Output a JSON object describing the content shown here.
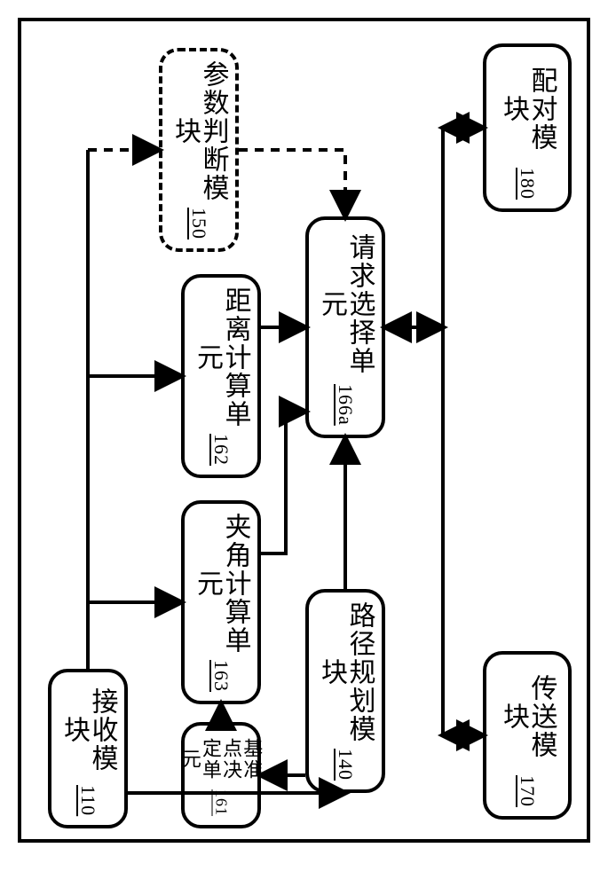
{
  "diagram": {
    "type": "block-diagram",
    "orientation": "vertical-labels",
    "nodes": {
      "receive": {
        "label": "接收模块",
        "ref": "110"
      },
      "route": {
        "label": "路径规划模块",
        "ref": "140"
      },
      "param": {
        "label": "参数判断模块",
        "ref": "150"
      },
      "refpoint": {
        "label": "基准点决定单元",
        "ref": "161"
      },
      "distance": {
        "label": "距离计算单元",
        "ref": "162"
      },
      "angle": {
        "label": "夹角计算单元",
        "ref": "163"
      },
      "select": {
        "label": "请求选择单元",
        "ref": "166a"
      },
      "transmit": {
        "label": "传送模块",
        "ref": "170"
      },
      "pair": {
        "label": "配对模块",
        "ref": "180"
      }
    },
    "edges": [
      {
        "from": "receive",
        "to": "route",
        "style": "solid",
        "bidir": false
      },
      {
        "from": "receive",
        "to": "distance",
        "style": "solid",
        "bidir": false,
        "via": "bus"
      },
      {
        "from": "receive",
        "to": "angle",
        "style": "solid",
        "bidir": false,
        "via": "bus"
      },
      {
        "from": "receive",
        "to": "param",
        "style": "dashed",
        "bidir": false,
        "via": "bus"
      },
      {
        "from": "route",
        "to": "refpoint",
        "style": "solid",
        "bidir": false
      },
      {
        "from": "refpoint",
        "to": "angle",
        "style": "solid",
        "bidir": false
      },
      {
        "from": "distance",
        "to": "select",
        "style": "solid",
        "bidir": false
      },
      {
        "from": "angle",
        "to": "select",
        "style": "solid",
        "bidir": false
      },
      {
        "from": "route",
        "to": "select",
        "style": "solid",
        "bidir": false
      },
      {
        "from": "param",
        "to": "select",
        "style": "dashed",
        "bidir": false
      },
      {
        "from": "select",
        "to": "pair",
        "style": "solid",
        "bidir": true,
        "shared_with": "transmit"
      },
      {
        "from": "select",
        "to": "transmit",
        "style": "solid",
        "bidir": true,
        "shared_with": "pair"
      }
    ]
  }
}
